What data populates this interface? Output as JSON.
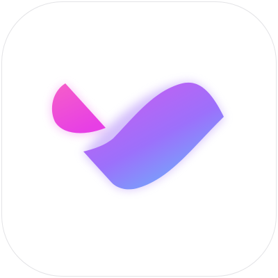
{
  "app_icon": {
    "name": "app-icon",
    "icon": "checkmark-logo-icon",
    "background": "#ffffff",
    "border": "#e3e3e6",
    "colors": {
      "leaf_top": "#f65ec8",
      "leaf_bottom": "#e73fe5",
      "swoosh_top_left": "#c460f2",
      "swoosh_mid": "#9c70fb",
      "swoosh_bottom_right": "#6bb2fb",
      "glow": "#e9a0f7"
    }
  }
}
